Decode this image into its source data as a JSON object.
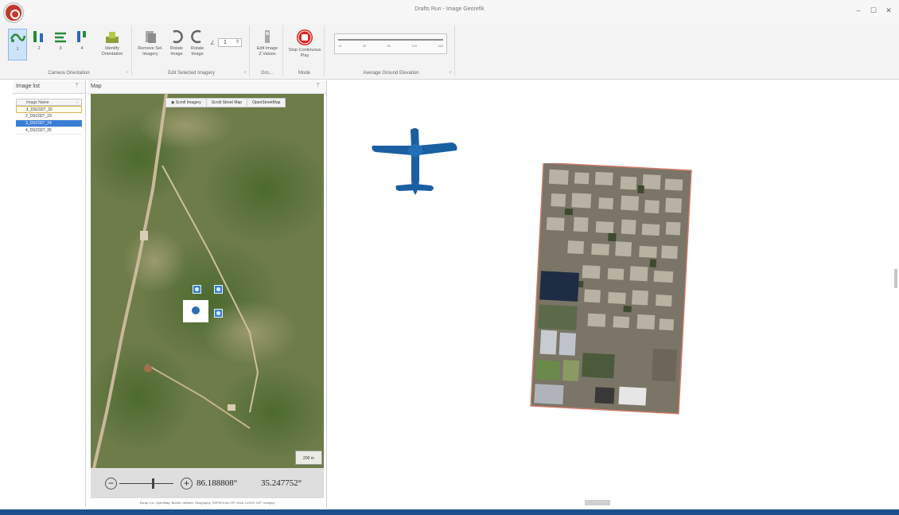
{
  "window": {
    "title": "Drafts Run - Image Georefik",
    "minimize": "–",
    "maximize": "☐",
    "close": "✕"
  },
  "ribbon": {
    "camera_orientation": {
      "label": "Camera Orientation",
      "buttons": [
        "1",
        "2",
        "3",
        "4"
      ],
      "identify_label": "Identify\nOrientation"
    },
    "edit_imagery": {
      "label": "Edit Selected Imagery",
      "buttons": [
        "Remove Sel.\nImagery",
        "Rotate\nImage",
        "Rotate\nImage"
      ],
      "stepper_value": "1"
    },
    "ground": {
      "label": "Gro...",
      "edit_label": "Edit Image\nZ Values"
    },
    "mode": {
      "label": "Mode",
      "stop_label": "Stop Continuous\nPlay"
    },
    "elevation": {
      "label": "Average Ground Elevation",
      "ticks": [
        "10",
        "40",
        "80",
        "120",
        "160"
      ]
    }
  },
  "image_list": {
    "title": "Image list",
    "column": "Image Name",
    "items": [
      "1_DSC027_22",
      "2_DSC027_23",
      "3_DSC027_24",
      "4_DSC027_25"
    ],
    "current_index": 0,
    "selected_index": 2
  },
  "map": {
    "title": "Map",
    "toolbar": [
      "Scroll Imagery",
      "Scroll Street Map",
      "OpenStreetMap"
    ],
    "scale": "200 m",
    "longitude": "86.188808°",
    "latitude": "35.247752°",
    "zoom_level_fraction": 0.62,
    "attribution": "Esrap: Inc, OpenMap: Bodhu; defined: Geography; SSP00 from OP; NGA, USGS; IGP; Imagery"
  },
  "colors": {
    "accent": "#1d4f8c",
    "selection": "#3a7dd4",
    "airplane": "#1b5fa3",
    "stop": "#e02020"
  }
}
